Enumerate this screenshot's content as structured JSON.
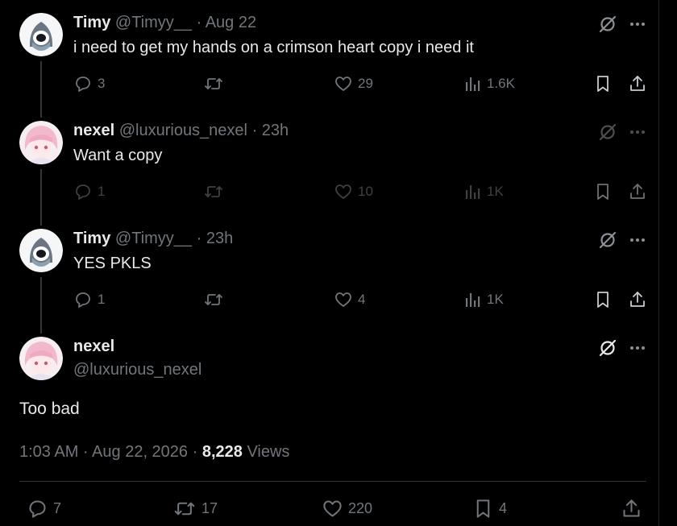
{
  "tweets": [
    {
      "name": "Timy",
      "handle": "@Timyy__",
      "dot": "·",
      "time": "Aug 22",
      "text": "i need to get my hands on a crimson heart copy i need it",
      "replies": "3",
      "retweets": "",
      "likes": "29",
      "views": "1.6K"
    },
    {
      "name": "nexel",
      "handle": "@luxurious_nexel",
      "dot": "·",
      "time": "23h",
      "text": "Want a copy",
      "replies": "1",
      "retweets": "",
      "likes": "10",
      "views": "1K"
    },
    {
      "name": "Timy",
      "handle": "@Timyy__",
      "dot": "·",
      "time": "23h",
      "text": "YES PKLS",
      "replies": "1",
      "retweets": "",
      "likes": "4",
      "views": "1K"
    }
  ],
  "main": {
    "name": "nexel",
    "handle": "@luxurious_nexel",
    "text": "Too bad",
    "time": "1:03 AM · Aug 22, 2026 · ",
    "views_count": "8,228",
    "views_label": " Views",
    "replies": "7",
    "retweets": "17",
    "likes": "220",
    "bookmarks": "4"
  },
  "icons": {
    "reply": "reply-icon",
    "retweet": "retweet-icon",
    "like": "heart-icon",
    "views": "views-icon",
    "bookmark": "bookmark-icon",
    "share": "share-icon",
    "grok": "grok-icon",
    "more": "more-icon"
  },
  "colors": {
    "background": "#000000",
    "text": "#e7e9ea",
    "muted": "#71767b",
    "line": "#333639"
  }
}
